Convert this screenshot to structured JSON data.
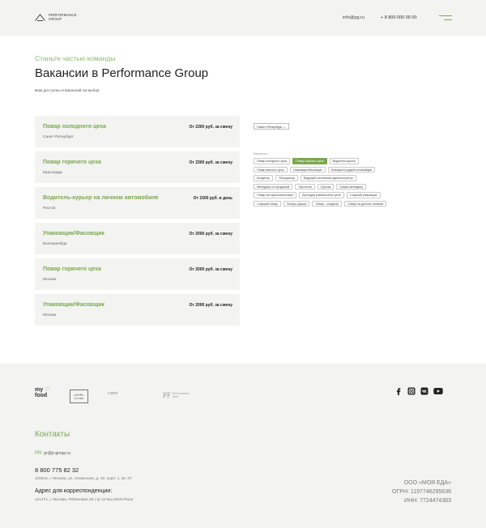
{
  "header": {
    "logo_text_line1": "Performance",
    "logo_text_line2": "Group",
    "email": "info@pg.ru",
    "phone": "+ 8 800 000 00 00",
    "menu_icon": "burger-menu-icon"
  },
  "main": {
    "kicker": "Станьте частью команды",
    "title": "Вакансии в Performance Group",
    "subtitle": "Вам доступны 6 вакансий на выбор",
    "jobs": [
      {
        "title": "Повар холодного цеха",
        "city": "Санкт-Петербург",
        "salary": "От 2300 руб. за смену"
      },
      {
        "title": "Повар горячего цеха",
        "city": "Краснодар",
        "salary": "От 2300 руб. за смену"
      },
      {
        "title": "Водитель-курьер на личном автомобиле",
        "city": "Ростов",
        "salary": "От 1500 руб. в день"
      },
      {
        "title": "Упаковщик/Фасовщик",
        "city": "Екатеринбург",
        "salary": "От 2000 руб. за смену"
      },
      {
        "title": "Повар горячего цеха",
        "city": "Москва",
        "salary": "От 2000 руб. за смену"
      },
      {
        "title": "Упаковщик/Фасовщик",
        "city": "Москва",
        "salary": "От 2000 руб. за смену"
      }
    ],
    "city_select": "Санкт-Петербург",
    "filter_label": "Вакансии",
    "tags": [
      "Повар холодного цеха",
      "Повар горячего цеха",
      "Водитель-курьер",
      "Повар мясного цеха",
      "Упаковщик/Фасовщик",
      "Мойщик посуды/Котломойщик",
      "Кондитер",
      "Уборщик/ца",
      "Ведущий системный администратор",
      "Менеджер по продажам",
      "Тортистка",
      "Грузчик",
      "Графи-менеджер",
      "Повар на пароконвектомат",
      "Бригадир упаковочного цеха",
      "Старший упаковщик",
      "Старший повар",
      "Пекарь-курьер",
      "Повар - кондитер",
      "Повар на детское питание"
    ],
    "active_tag_index": 1
  },
  "footer": {
    "brands": {
      "myfood_line1": "my",
      "myfood_line2": "food",
      "level_line1": "LEVEL",
      "level_line2": "KITCHEN",
      "chef": "CHEF",
      "pf_mark": "PF",
      "pf_line1": "Performance",
      "pf_line2": "food"
    },
    "socials": [
      "facebook-icon",
      "instagram-icon",
      "vk-icon",
      "youtube-icon"
    ],
    "contacts_title": "Контакты",
    "pr_label": "PR:",
    "pr_email": "pr@p-group.ru",
    "phone": "8 800 775 82 32",
    "address": "115516, г. Москва, ул. Севанская, д. 32, корп. 1, кв. 37",
    "corr_title": "Адрес для корреспонденции:",
    "corr_address": "121471, г. Москва, Рябиновая 26 стр 10 БЦ West Plaza",
    "legal_name": "ООО «МОЯ ЕДА»",
    "ogrn": "ОГРН: 1197746295636",
    "inn": "ИНН: 7724474363"
  },
  "colors": {
    "accent": "#7aa84f",
    "background": "#f3f3f1",
    "main_bg": "#ffffff"
  }
}
